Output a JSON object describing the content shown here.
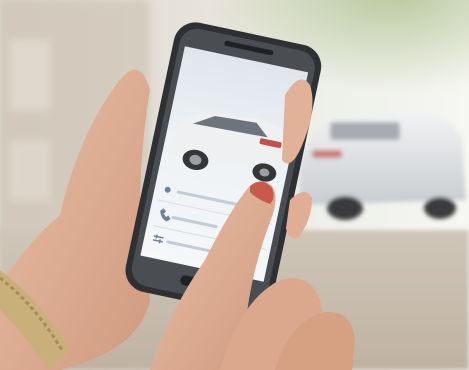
{
  "scene": {
    "description_subject": "phone-app-photo",
    "palette": {
      "sky": "#f4f5f2",
      "building": "#d8d1c6",
      "foliage": "#a7b58a",
      "road": "#cfc7bb",
      "phone_body": "#2e3033",
      "screen_bg": "#e7edf2",
      "screen_text": "#6f8296",
      "suv_body": "#c8ccd1",
      "skin": "#e3b49a",
      "nail": "#c75a4a",
      "bracelet": "#c9b07a"
    }
  },
  "app": {
    "menu_items": [
      {
        "icon": "location-pin-icon"
      },
      {
        "icon": "phone-icon"
      },
      {
        "icon": "sliders-icon"
      }
    ]
  }
}
